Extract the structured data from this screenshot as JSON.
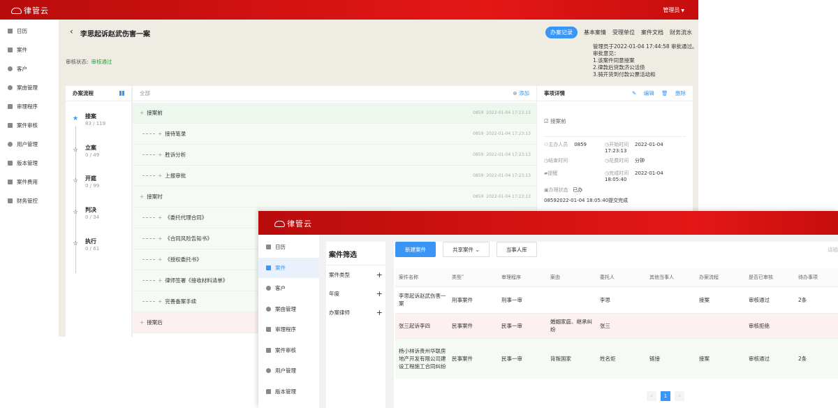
{
  "app": {
    "name": "律管云"
  },
  "header": {
    "user": "管理员"
  },
  "sidebar1": {
    "items": [
      "日历",
      "案件",
      "客户",
      "案由管理",
      "审理程序",
      "案件审核",
      "用户管理",
      "版本管理",
      "案件费用",
      "财务管控"
    ]
  },
  "case": {
    "title": "李思起诉赵武伤害一案",
    "tabs": [
      "办案记录",
      "基本案情",
      "受理单位",
      "案件文档",
      "财务流水"
    ],
    "status_label": "审核状态:",
    "status_value": "审核通过",
    "audit_note": [
      "管理员于2022-01-04 17:44:58 审批通过。",
      "审批意见：",
      "1.该案件同意接案",
      "2.律款后贷款济公活债",
      "3.骑开货到付款公票活动和"
    ]
  },
  "flow": {
    "title": "办案流程",
    "stages": [
      {
        "name": "接案",
        "count": "83 / 119"
      },
      {
        "name": "立案",
        "count": "0 / 49"
      },
      {
        "name": "开庭",
        "count": "0 / 99"
      },
      {
        "name": "判决",
        "count": "0 / 34"
      },
      {
        "name": "执行",
        "count": "0 / 61"
      }
    ]
  },
  "tasks": {
    "all_label": "全部",
    "add_label": "添加",
    "meta_user": "0859",
    "meta_time": "2022-01-04 17:23:13",
    "rows": [
      "接案前",
      "接待笔录",
      "胜诉分析",
      "上报审批",
      "接案时",
      "《委托代理合同》",
      "《合同风险告知书》",
      "《授权委托书》",
      "律师签署《接收材料清单》",
      "完善备案手续",
      "接案后"
    ]
  },
  "detail": {
    "title": "事项详情",
    "edit_label": "编辑",
    "delete_label": "删除",
    "stage": "接案前",
    "lead_label": "主办人员",
    "lead_value": "0859",
    "start_label": "开始时间",
    "start_value": "2022-01-04 17:23:13",
    "end_label": "结束时间",
    "duration_label": "花费时间",
    "duration_value": "分钟",
    "remind_label": "提醒",
    "done_label": "完成时间",
    "done_value": "2022-01-04 18:05:40",
    "state_label": "办理状态",
    "state_value": "已办",
    "log": "08592022-01-04 18:05:40提交完成"
  },
  "sidebar2": {
    "items": [
      "日历",
      "案件",
      "客户",
      "案由管理",
      "审理程序",
      "案件审核",
      "用户管理",
      "版本管理"
    ]
  },
  "filter": {
    "title": "案件筛选",
    "items": [
      "案件类型",
      "年度",
      "办案律师"
    ]
  },
  "list": {
    "buttons": [
      "新建案件",
      "共享案件",
      "当事人库"
    ],
    "search_hint": "请输",
    "columns": [
      "案件名称",
      "类型",
      "审理程序",
      "案由",
      "委托人",
      "其他当事人",
      "办案流程",
      "是否已审核",
      "待办事项"
    ],
    "rows": [
      [
        "李思起诉赵武伤害一案",
        "刑事案件",
        "刑事一审",
        "",
        "李思",
        "",
        "接案",
        "审核通过",
        "2条"
      ],
      [
        "张三起诉李四",
        "民事案件",
        "民事一审",
        "婚姻家庭、继承纠纷",
        "张三",
        "",
        "",
        "审核拒绝",
        ""
      ],
      [
        "杨小林诉贵州华联房地产开发有限公司建设工程施工合同纠纷",
        "民事案件",
        "民事一审",
        "背叛国家",
        "姓名炬",
        "链接",
        "接案",
        "审核通过",
        "2条"
      ]
    ],
    "page": "1"
  }
}
